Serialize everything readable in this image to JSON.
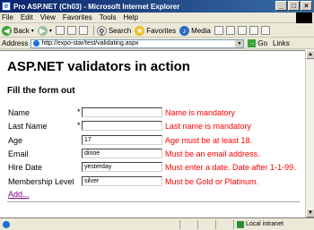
{
  "window": {
    "title": "Pro ASP.NET (Ch03) - Microsoft Internet Explorer",
    "controls": [
      "_",
      "□",
      "×"
    ]
  },
  "menu": [
    "File",
    "Edit",
    "View",
    "Favorites",
    "Tools",
    "Help"
  ],
  "toolbar": {
    "back": "Back",
    "search": "Search",
    "favorites": "Favorites",
    "media": "Media"
  },
  "address": {
    "label": "Address",
    "url": "http://expo-star/test/validating.aspx",
    "go": "Go",
    "links": "Links"
  },
  "page": {
    "heading": "ASP.NET validators in action",
    "subheading": "Fill the form out",
    "fields": [
      {
        "label": "Name",
        "required": "*",
        "value": "",
        "error": "Name is mandatory"
      },
      {
        "label": "Last Name",
        "required": "*",
        "value": "",
        "error": "Last name is mandatory"
      },
      {
        "label": "Age",
        "required": "",
        "value": "17",
        "error": "Age must be at least 18."
      },
      {
        "label": "Email",
        "required": "",
        "value": "dinoe",
        "error": "Must be an email address."
      },
      {
        "label": "Hire Date",
        "required": "",
        "value": "yesterday",
        "error": "Must enter a date. Date after 1-1-99."
      },
      {
        "label": "Membership Level",
        "required": "",
        "value": "silver",
        "error": "Must be Gold or Platinum."
      }
    ],
    "add_link": "Add..."
  },
  "status": {
    "zone": "Local intranet"
  }
}
